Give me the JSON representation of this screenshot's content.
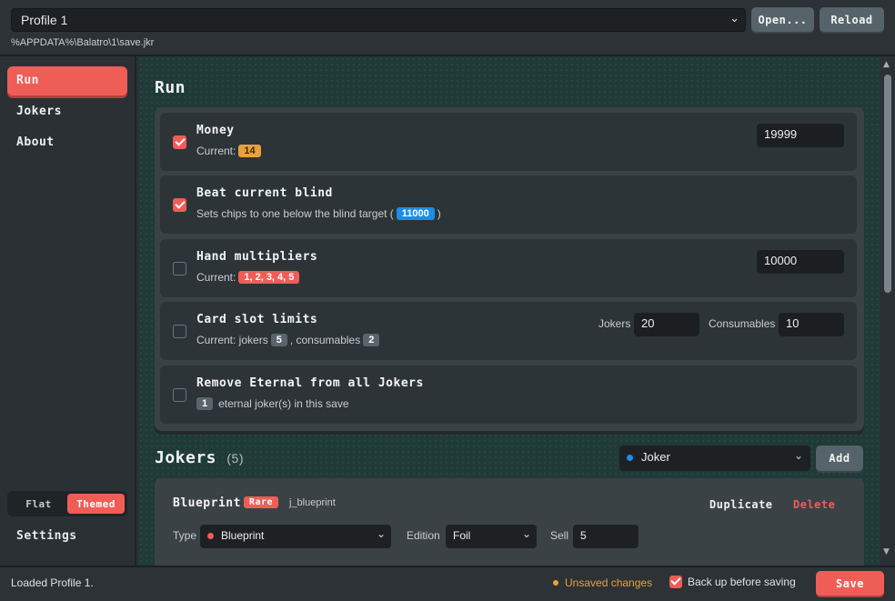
{
  "topbar": {
    "profile_value": "Profile 1",
    "open_label": "Open...",
    "reload_label": "Reload",
    "save_path": "%APPDATA%\\Balatro\\1\\save.jkr"
  },
  "sidebar": {
    "items": [
      {
        "label": "Run",
        "active": true
      },
      {
        "label": "Jokers",
        "active": false
      },
      {
        "label": "About",
        "active": false
      }
    ],
    "theme_flat": "Flat",
    "theme_themed": "Themed",
    "settings_label": "Settings"
  },
  "run": {
    "title": "Run",
    "rows": [
      {
        "title": "Money",
        "sub_prefix": "Current:",
        "badge": "14",
        "checked": true,
        "input": "19999"
      },
      {
        "title": "Beat current blind",
        "sub_prefix": "Sets chips to one below the blind target (",
        "badge": "11000",
        "sub_suffix": ")",
        "checked": true
      },
      {
        "title": "Hand multipliers",
        "sub_prefix": "Current:",
        "badge": "1, 2, 3, 4, 5",
        "checked": false,
        "input": "10000"
      },
      {
        "title": "Card slot limits",
        "sub_prefix": "Current: jokers",
        "badge": "5",
        "sub_mid": ", consumables",
        "badge2": "2",
        "checked": false,
        "jokers_label": "Jokers",
        "jokers_value": "20",
        "consumables_label": "Consumables",
        "consumables_value": "10"
      },
      {
        "title": "Remove Eternal from all Jokers",
        "badge": "1",
        "sub_suffix": "eternal joker(s) in this save",
        "checked": false
      }
    ]
  },
  "jokers": {
    "title": "Jokers",
    "count": "(5)",
    "select_value": "Joker",
    "add_label": "Add",
    "card": {
      "name": "Blueprint",
      "rarity": "Rare",
      "id": "j_blueprint",
      "duplicate_label": "Duplicate",
      "delete_label": "Delete",
      "type_label": "Type",
      "type_value": "Blueprint",
      "edition_label": "Edition",
      "edition_value": "Foil",
      "sell_label": "Sell",
      "sell_value": "5"
    }
  },
  "status": {
    "message": "Loaded Profile 1.",
    "unsaved": "Unsaved changes",
    "backup_label": "Back up before saving",
    "save_label": "Save"
  },
  "colors": {
    "accent": "#ef5d57",
    "warning": "#e6a23c",
    "info": "#1c8ee8",
    "main_bg": "#1f3a37",
    "panel": "#3a4246"
  },
  "icons": {
    "chevron": "chevron-down-icon",
    "check": "checkmark-icon"
  }
}
